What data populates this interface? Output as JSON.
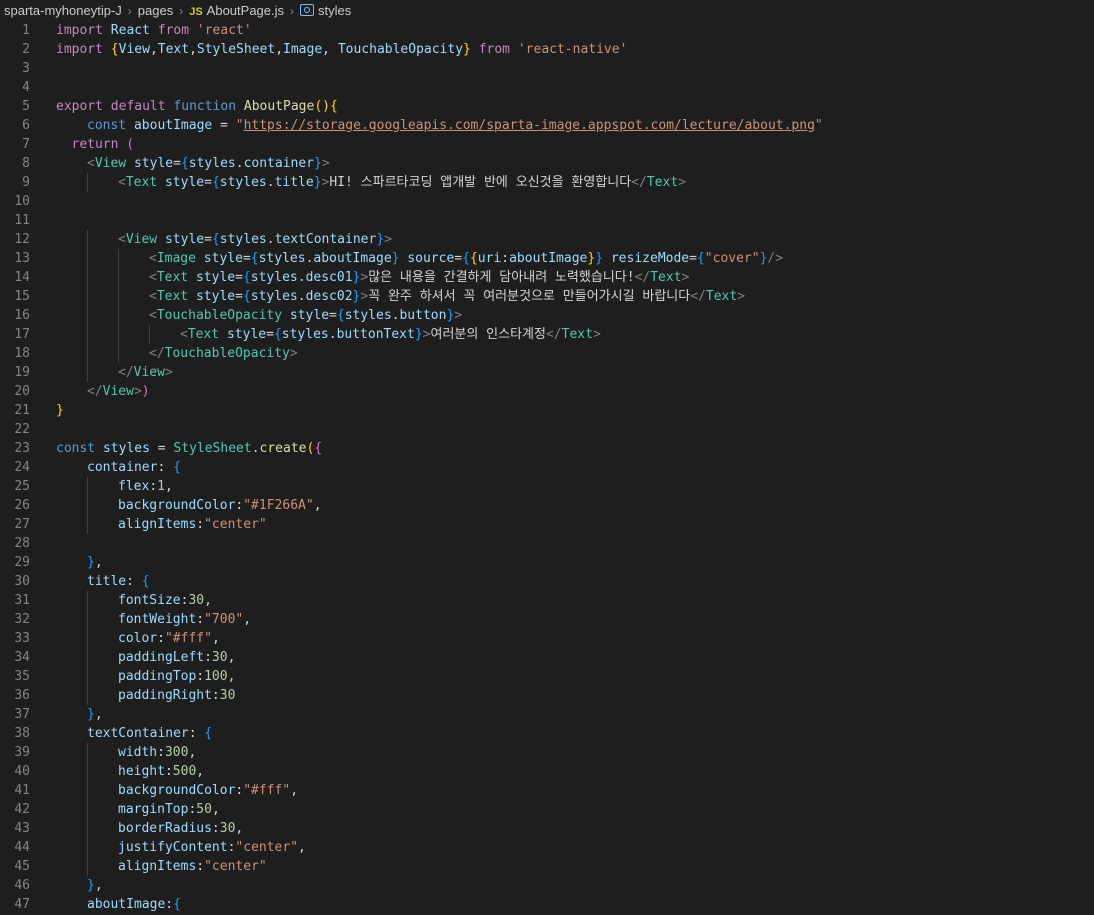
{
  "breadcrumb": {
    "folder": "sparta-myhoneytip-J",
    "subfolder": "pages",
    "file_icon": "JS",
    "file": "AboutPage.js",
    "symbol": "styles"
  },
  "lines": [
    {
      "n": 1,
      "indent": 0,
      "tokens": [
        [
          "kw2",
          "import"
        ],
        [
          "txt",
          " "
        ],
        [
          "var",
          "React"
        ],
        [
          "txt",
          " "
        ],
        [
          "kw2",
          "from"
        ],
        [
          "txt",
          " "
        ],
        [
          "str",
          "'react'"
        ]
      ]
    },
    {
      "n": 2,
      "indent": 0,
      "tokens": [
        [
          "kw2",
          "import"
        ],
        [
          "txt",
          " "
        ],
        [
          "br1",
          "{"
        ],
        [
          "var",
          "View"
        ],
        [
          "txt",
          ","
        ],
        [
          "var",
          "Text"
        ],
        [
          "txt",
          ","
        ],
        [
          "var",
          "StyleSheet"
        ],
        [
          "txt",
          ","
        ],
        [
          "var",
          "Image"
        ],
        [
          "txt",
          ", "
        ],
        [
          "var",
          "TouchableOpacity"
        ],
        [
          "br1",
          "}"
        ],
        [
          "txt",
          " "
        ],
        [
          "kw2",
          "from"
        ],
        [
          "txt",
          " "
        ],
        [
          "str",
          "'react-native'"
        ]
      ]
    },
    {
      "n": 3,
      "indent": 0,
      "tokens": []
    },
    {
      "n": 4,
      "indent": 0,
      "tokens": []
    },
    {
      "n": 5,
      "indent": 0,
      "tokens": [
        [
          "kw2",
          "export"
        ],
        [
          "txt",
          " "
        ],
        [
          "kw2",
          "default"
        ],
        [
          "txt",
          " "
        ],
        [
          "kw",
          "function"
        ],
        [
          "txt",
          " "
        ],
        [
          "fn",
          "AboutPage"
        ],
        [
          "br1",
          "()"
        ],
        [
          "br1",
          "{"
        ]
      ]
    },
    {
      "n": 6,
      "indent": 1,
      "tokens": [
        [
          "kw",
          "const"
        ],
        [
          "txt",
          " "
        ],
        [
          "var",
          "aboutImage"
        ],
        [
          "txt",
          " = "
        ],
        [
          "str",
          "\""
        ],
        [
          "url",
          "https://storage.googleapis.com/sparta-image.appspot.com/lecture/about.png"
        ],
        [
          "str",
          "\""
        ]
      ]
    },
    {
      "n": 7,
      "indent": 0.5,
      "tokens": [
        [
          "kw2",
          "return"
        ],
        [
          "txt",
          " "
        ],
        [
          "br2",
          "("
        ]
      ]
    },
    {
      "n": 8,
      "indent": 1,
      "tokens": [
        [
          "punc",
          "<"
        ],
        [
          "tag",
          "View"
        ],
        [
          "txt",
          " "
        ],
        [
          "var",
          "style"
        ],
        [
          "txt",
          "="
        ],
        [
          "br3",
          "{"
        ],
        [
          "var",
          "styles"
        ],
        [
          "txt",
          "."
        ],
        [
          "var",
          "container"
        ],
        [
          "br3",
          "}"
        ],
        [
          "punc",
          ">"
        ]
      ]
    },
    {
      "n": 9,
      "indent": 2,
      "tokens": [
        [
          "punc",
          "<"
        ],
        [
          "tag",
          "Text"
        ],
        [
          "txt",
          " "
        ],
        [
          "var",
          "style"
        ],
        [
          "txt",
          "="
        ],
        [
          "br3",
          "{"
        ],
        [
          "var",
          "styles"
        ],
        [
          "txt",
          "."
        ],
        [
          "var",
          "title"
        ],
        [
          "br3",
          "}"
        ],
        [
          "punc",
          ">"
        ],
        [
          "txt",
          "HI! 스파르타코딩 앱개발 반에 오신것을 환영합니다"
        ],
        [
          "punc",
          "</"
        ],
        [
          "tag",
          "Text"
        ],
        [
          "punc",
          ">"
        ]
      ]
    },
    {
      "n": 10,
      "indent": 0,
      "tokens": []
    },
    {
      "n": 11,
      "indent": 0,
      "tokens": []
    },
    {
      "n": 12,
      "indent": 2,
      "tokens": [
        [
          "punc",
          "<"
        ],
        [
          "tag",
          "View"
        ],
        [
          "txt",
          " "
        ],
        [
          "var",
          "style"
        ],
        [
          "txt",
          "="
        ],
        [
          "br3",
          "{"
        ],
        [
          "var",
          "styles"
        ],
        [
          "txt",
          "."
        ],
        [
          "var",
          "textContainer"
        ],
        [
          "br3",
          "}"
        ],
        [
          "punc",
          ">"
        ]
      ]
    },
    {
      "n": 13,
      "indent": 3,
      "tokens": [
        [
          "punc",
          "<"
        ],
        [
          "tag",
          "Image"
        ],
        [
          "txt",
          " "
        ],
        [
          "var",
          "style"
        ],
        [
          "txt",
          "="
        ],
        [
          "br3",
          "{"
        ],
        [
          "var",
          "styles"
        ],
        [
          "txt",
          "."
        ],
        [
          "var",
          "aboutImage"
        ],
        [
          "br3",
          "}"
        ],
        [
          "txt",
          " "
        ],
        [
          "var",
          "source"
        ],
        [
          "txt",
          "="
        ],
        [
          "br3",
          "{"
        ],
        [
          "br1",
          "{"
        ],
        [
          "var",
          "uri"
        ],
        [
          "txt",
          ":"
        ],
        [
          "var",
          "aboutImage"
        ],
        [
          "br1",
          "}"
        ],
        [
          "br3",
          "}"
        ],
        [
          "txt",
          " "
        ],
        [
          "var",
          "resizeMode"
        ],
        [
          "txt",
          "="
        ],
        [
          "br3",
          "{"
        ],
        [
          "str",
          "\"cover\""
        ],
        [
          "br3",
          "}"
        ],
        [
          "punc",
          "/>"
        ]
      ]
    },
    {
      "n": 14,
      "indent": 3,
      "tokens": [
        [
          "punc",
          "<"
        ],
        [
          "tag",
          "Text"
        ],
        [
          "txt",
          " "
        ],
        [
          "var",
          "style"
        ],
        [
          "txt",
          "="
        ],
        [
          "br3",
          "{"
        ],
        [
          "var",
          "styles"
        ],
        [
          "txt",
          "."
        ],
        [
          "var",
          "desc01"
        ],
        [
          "br3",
          "}"
        ],
        [
          "punc",
          ">"
        ],
        [
          "txt",
          "많은 내용을 간결하게 담아내려 노력했습니다!"
        ],
        [
          "punc",
          "</"
        ],
        [
          "tag",
          "Text"
        ],
        [
          "punc",
          ">"
        ]
      ]
    },
    {
      "n": 15,
      "indent": 3,
      "tokens": [
        [
          "punc",
          "<"
        ],
        [
          "tag",
          "Text"
        ],
        [
          "txt",
          " "
        ],
        [
          "var",
          "style"
        ],
        [
          "txt",
          "="
        ],
        [
          "br3",
          "{"
        ],
        [
          "var",
          "styles"
        ],
        [
          "txt",
          "."
        ],
        [
          "var",
          "desc02"
        ],
        [
          "br3",
          "}"
        ],
        [
          "punc",
          ">"
        ],
        [
          "txt",
          "꼭 완주 하셔서 꼭 여러분것으로 만들어가시길 바랍니다"
        ],
        [
          "punc",
          "</"
        ],
        [
          "tag",
          "Text"
        ],
        [
          "punc",
          ">"
        ]
      ]
    },
    {
      "n": 16,
      "indent": 3,
      "tokens": [
        [
          "punc",
          "<"
        ],
        [
          "tag",
          "TouchableOpacity"
        ],
        [
          "txt",
          " "
        ],
        [
          "var",
          "style"
        ],
        [
          "txt",
          "="
        ],
        [
          "br3",
          "{"
        ],
        [
          "var",
          "styles"
        ],
        [
          "txt",
          "."
        ],
        [
          "var",
          "button"
        ],
        [
          "br3",
          "}"
        ],
        [
          "punc",
          ">"
        ]
      ]
    },
    {
      "n": 17,
      "indent": 4,
      "tokens": [
        [
          "punc",
          "<"
        ],
        [
          "tag",
          "Text"
        ],
        [
          "txt",
          " "
        ],
        [
          "var",
          "style"
        ],
        [
          "txt",
          "="
        ],
        [
          "br3",
          "{"
        ],
        [
          "var",
          "styles"
        ],
        [
          "txt",
          "."
        ],
        [
          "var",
          "buttonText"
        ],
        [
          "br3",
          "}"
        ],
        [
          "punc",
          ">"
        ],
        [
          "txt",
          "여러분의 인스타계정"
        ],
        [
          "punc",
          "</"
        ],
        [
          "tag",
          "Text"
        ],
        [
          "punc",
          ">"
        ]
      ]
    },
    {
      "n": 18,
      "indent": 3,
      "tokens": [
        [
          "punc",
          "</"
        ],
        [
          "tag",
          "TouchableOpacity"
        ],
        [
          "punc",
          ">"
        ]
      ]
    },
    {
      "n": 19,
      "indent": 2,
      "tokens": [
        [
          "punc",
          "</"
        ],
        [
          "tag",
          "View"
        ],
        [
          "punc",
          ">"
        ]
      ]
    },
    {
      "n": 20,
      "indent": 1,
      "tokens": [
        [
          "punc",
          "</"
        ],
        [
          "tag",
          "View"
        ],
        [
          "punc",
          ">"
        ],
        [
          "br2",
          ")"
        ]
      ]
    },
    {
      "n": 21,
      "indent": 0,
      "tokens": [
        [
          "br1",
          "}"
        ]
      ]
    },
    {
      "n": 22,
      "indent": 0,
      "tokens": []
    },
    {
      "n": 23,
      "indent": 0,
      "tokens": [
        [
          "kw",
          "const"
        ],
        [
          "txt",
          " "
        ],
        [
          "var",
          "styles"
        ],
        [
          "txt",
          " = "
        ],
        [
          "cls",
          "StyleSheet"
        ],
        [
          "txt",
          "."
        ],
        [
          "fn",
          "create"
        ],
        [
          "br1",
          "("
        ],
        [
          "br2",
          "{"
        ]
      ]
    },
    {
      "n": 24,
      "indent": 1,
      "tokens": [
        [
          "var",
          "container"
        ],
        [
          "txt",
          ": "
        ],
        [
          "br3",
          "{"
        ]
      ]
    },
    {
      "n": 25,
      "indent": 2,
      "tokens": [
        [
          "var",
          "flex"
        ],
        [
          "txt",
          ":"
        ],
        [
          "num",
          "1"
        ],
        [
          "txt",
          ","
        ]
      ]
    },
    {
      "n": 26,
      "indent": 2,
      "tokens": [
        [
          "var",
          "backgroundColor"
        ],
        [
          "txt",
          ":"
        ],
        [
          "str",
          "\"#1F266A\""
        ],
        [
          "txt",
          ","
        ]
      ]
    },
    {
      "n": 27,
      "indent": 2,
      "tokens": [
        [
          "var",
          "alignItems"
        ],
        [
          "txt",
          ":"
        ],
        [
          "str",
          "\"center\""
        ]
      ]
    },
    {
      "n": 28,
      "indent": 0,
      "tokens": []
    },
    {
      "n": 29,
      "indent": 1,
      "tokens": [
        [
          "br3",
          "}"
        ],
        [
          "txt",
          ","
        ]
      ]
    },
    {
      "n": 30,
      "indent": 1,
      "tokens": [
        [
          "var",
          "title"
        ],
        [
          "txt",
          ": "
        ],
        [
          "br3",
          "{"
        ]
      ]
    },
    {
      "n": 31,
      "indent": 2,
      "tokens": [
        [
          "var",
          "fontSize"
        ],
        [
          "txt",
          ":"
        ],
        [
          "num",
          "30"
        ],
        [
          "txt",
          ","
        ]
      ]
    },
    {
      "n": 32,
      "indent": 2,
      "tokens": [
        [
          "var",
          "fontWeight"
        ],
        [
          "txt",
          ":"
        ],
        [
          "str",
          "\"700\""
        ],
        [
          "txt",
          ","
        ]
      ]
    },
    {
      "n": 33,
      "indent": 2,
      "tokens": [
        [
          "var",
          "color"
        ],
        [
          "txt",
          ":"
        ],
        [
          "str",
          "\"#fff\""
        ],
        [
          "txt",
          ","
        ]
      ]
    },
    {
      "n": 34,
      "indent": 2,
      "tokens": [
        [
          "var",
          "paddingLeft"
        ],
        [
          "txt",
          ":"
        ],
        [
          "num",
          "30"
        ],
        [
          "txt",
          ","
        ]
      ]
    },
    {
      "n": 35,
      "indent": 2,
      "tokens": [
        [
          "var",
          "paddingTop"
        ],
        [
          "txt",
          ":"
        ],
        [
          "num",
          "100"
        ],
        [
          "txt",
          ","
        ]
      ]
    },
    {
      "n": 36,
      "indent": 2,
      "tokens": [
        [
          "var",
          "paddingRight"
        ],
        [
          "txt",
          ":"
        ],
        [
          "num",
          "30"
        ]
      ]
    },
    {
      "n": 37,
      "indent": 1,
      "tokens": [
        [
          "br3",
          "}"
        ],
        [
          "txt",
          ","
        ]
      ]
    },
    {
      "n": 38,
      "indent": 1,
      "tokens": [
        [
          "var",
          "textContainer"
        ],
        [
          "txt",
          ": "
        ],
        [
          "br3",
          "{"
        ]
      ]
    },
    {
      "n": 39,
      "indent": 2,
      "tokens": [
        [
          "var",
          "width"
        ],
        [
          "txt",
          ":"
        ],
        [
          "num",
          "300"
        ],
        [
          "txt",
          ","
        ]
      ]
    },
    {
      "n": 40,
      "indent": 2,
      "tokens": [
        [
          "var",
          "height"
        ],
        [
          "txt",
          ":"
        ],
        [
          "num",
          "500"
        ],
        [
          "txt",
          ","
        ]
      ]
    },
    {
      "n": 41,
      "indent": 2,
      "tokens": [
        [
          "var",
          "backgroundColor"
        ],
        [
          "txt",
          ":"
        ],
        [
          "str",
          "\"#fff\""
        ],
        [
          "txt",
          ","
        ]
      ]
    },
    {
      "n": 42,
      "indent": 2,
      "tokens": [
        [
          "var",
          "marginTop"
        ],
        [
          "txt",
          ":"
        ],
        [
          "num",
          "50"
        ],
        [
          "txt",
          ","
        ]
      ]
    },
    {
      "n": 43,
      "indent": 2,
      "tokens": [
        [
          "var",
          "borderRadius"
        ],
        [
          "txt",
          ":"
        ],
        [
          "num",
          "30"
        ],
        [
          "txt",
          ","
        ]
      ]
    },
    {
      "n": 44,
      "indent": 2,
      "tokens": [
        [
          "var",
          "justifyContent"
        ],
        [
          "txt",
          ":"
        ],
        [
          "str",
          "\"center\""
        ],
        [
          "txt",
          ","
        ]
      ]
    },
    {
      "n": 45,
      "indent": 2,
      "tokens": [
        [
          "var",
          "alignItems"
        ],
        [
          "txt",
          ":"
        ],
        [
          "str",
          "\"center\""
        ]
      ]
    },
    {
      "n": 46,
      "indent": 1,
      "tokens": [
        [
          "br3",
          "}"
        ],
        [
          "txt",
          ","
        ]
      ]
    },
    {
      "n": 47,
      "indent": 1,
      "tokens": [
        [
          "var",
          "aboutImage"
        ],
        [
          "txt",
          ":"
        ],
        [
          "br3",
          "{"
        ]
      ]
    }
  ]
}
